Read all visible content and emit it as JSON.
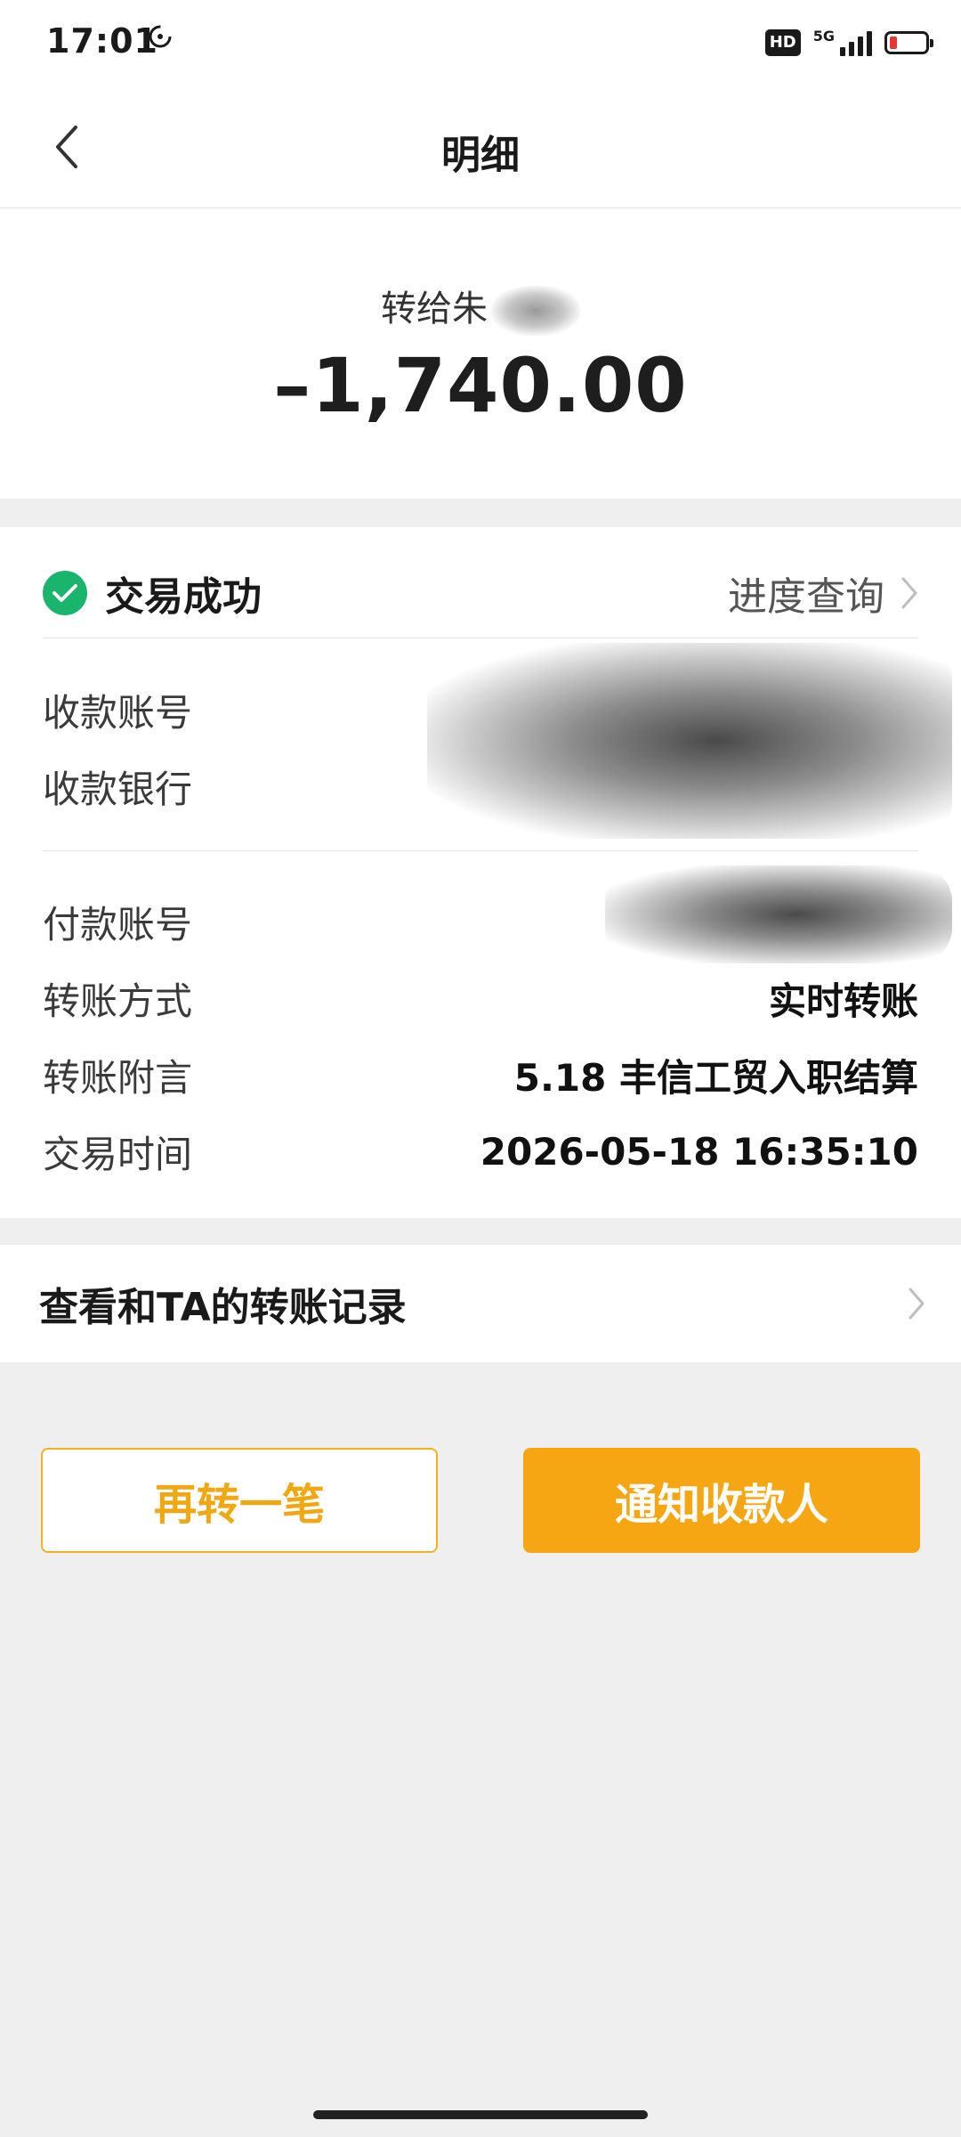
{
  "status_bar": {
    "time": "17:01",
    "hd": "HD",
    "network": "5G"
  },
  "header": {
    "title": "明细"
  },
  "summary": {
    "recipient_prefix": "转给朱",
    "amount": "–1,740.00"
  },
  "transaction": {
    "status": "交易成功",
    "progress_label": "进度查询"
  },
  "details": {
    "payee_account_label": "收款账号",
    "payee_bank_label": "收款银行",
    "payer_account_label": "付款账号",
    "method_label": "转账方式",
    "method_value": "实时转账",
    "remark_label": "转账附言",
    "remark_value": "5.18 丰信工贸入职结算",
    "time_label": "交易时间",
    "time_value": "2026-05-18 16:35:10"
  },
  "records": {
    "label": "查看和TA的转账记录"
  },
  "actions": {
    "again_label": "再转一笔",
    "notify_label": "通知收款人"
  },
  "colors": {
    "success": "#19b56d",
    "accent": "#f7a613",
    "background": "#efefef"
  },
  "icons": [
    "back-chevron-icon",
    "check-circle-icon",
    "chevron-right-icon",
    "sync-icon",
    "signal-icon",
    "battery-icon"
  ]
}
